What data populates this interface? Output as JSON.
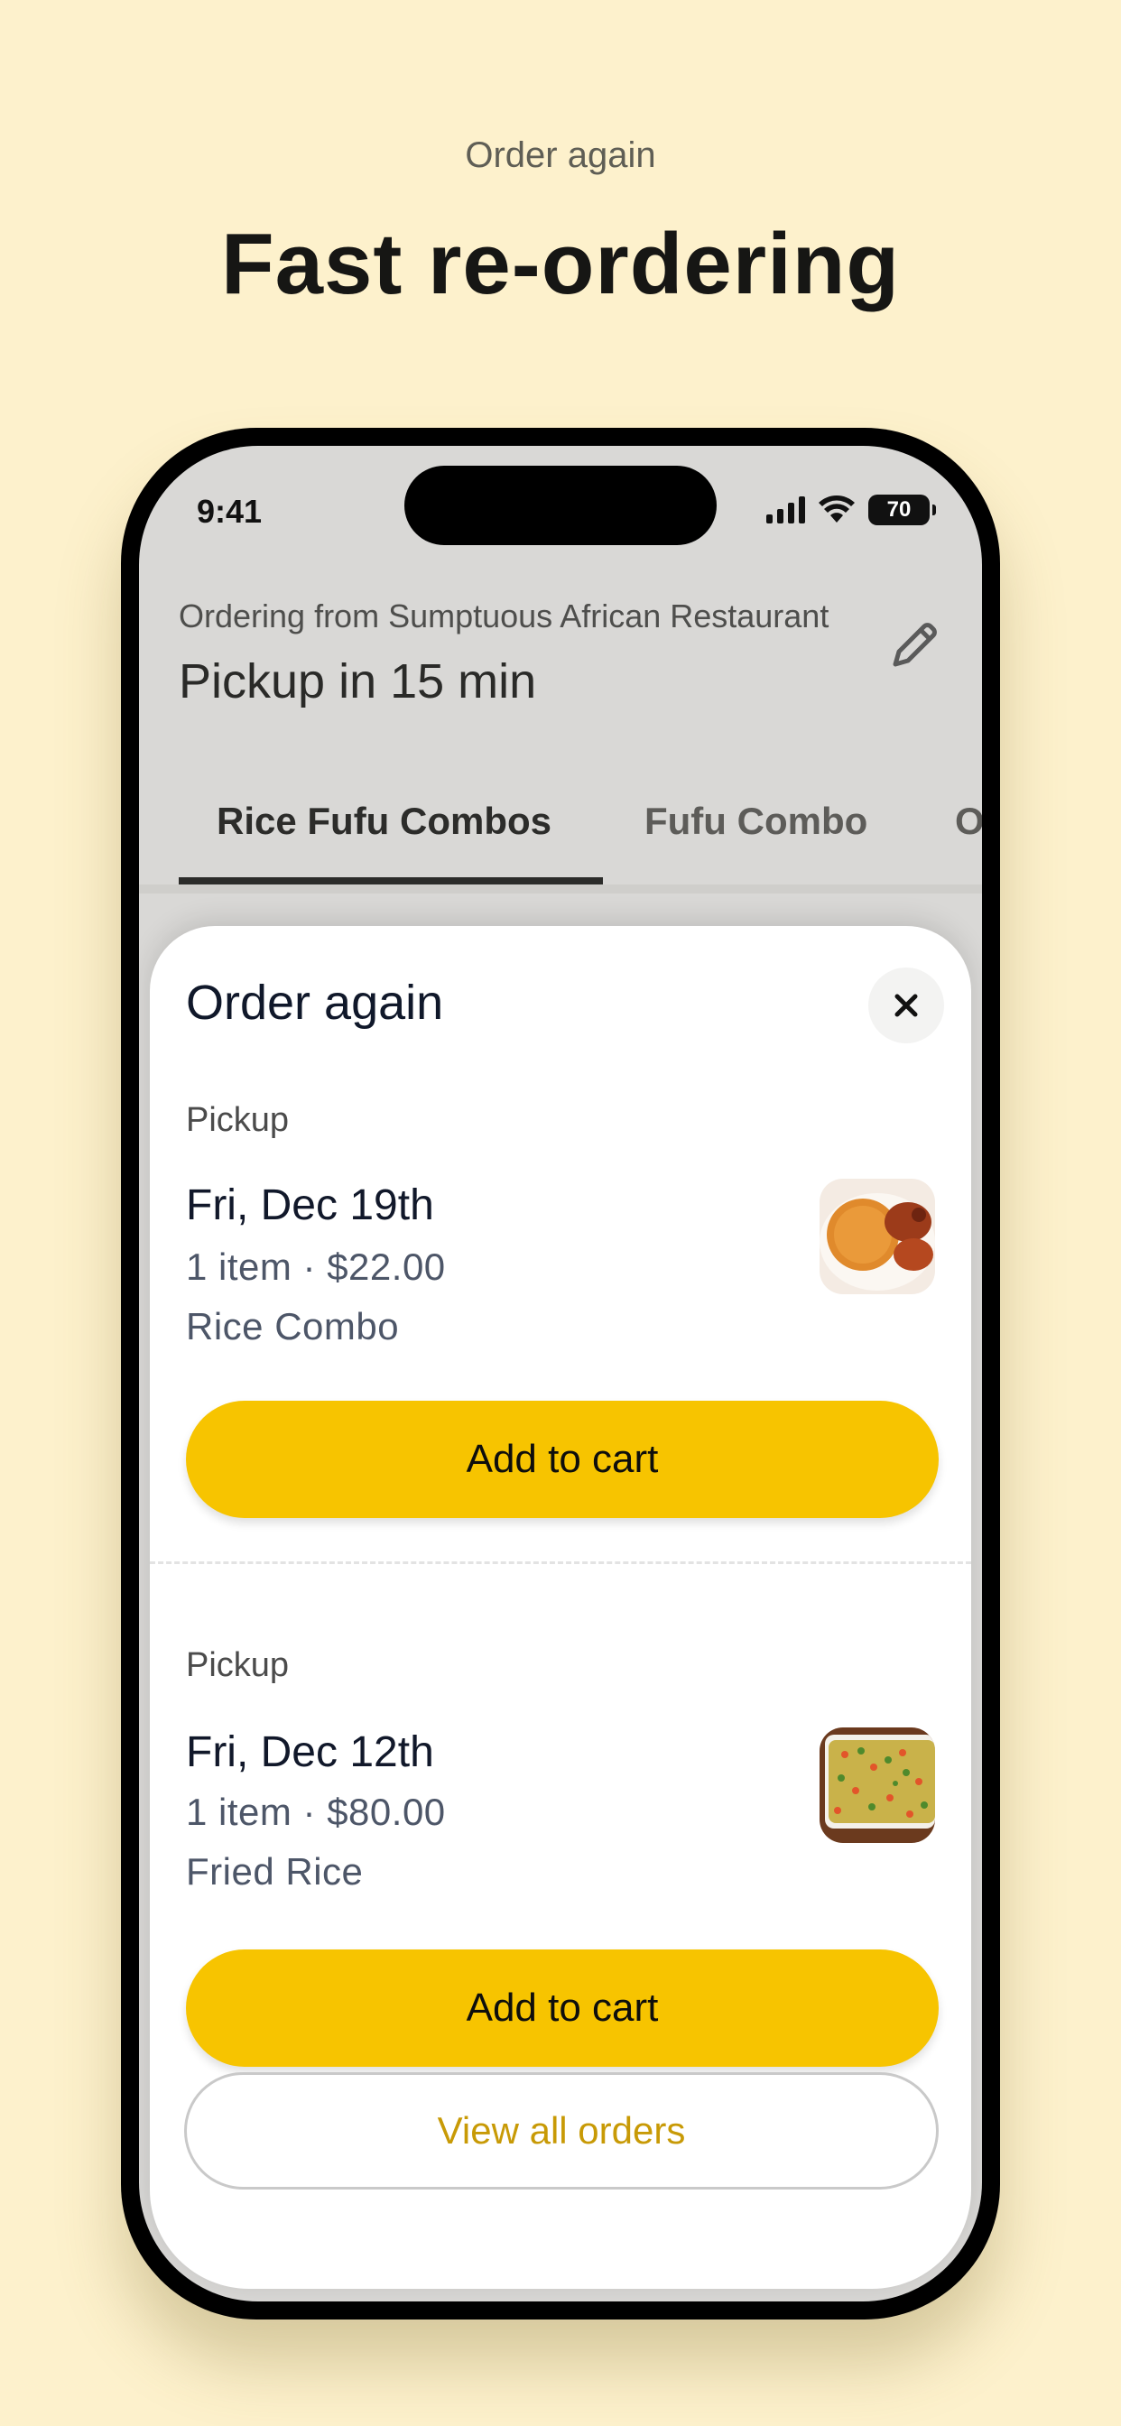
{
  "page": {
    "eyebrow": "Order again",
    "headline": "Fast re-ordering"
  },
  "status_bar": {
    "time": "9:41",
    "battery": "70",
    "icons": [
      "signal-icon",
      "wifi-icon",
      "battery-icon"
    ]
  },
  "header": {
    "ordering_from": "Ordering from Sumptuous African Restaurant",
    "pickup_time": "Pickup in 15 min",
    "edit_icon": "pencil-icon"
  },
  "tabs": [
    {
      "label": "Rice Fufu Combos",
      "active": true
    },
    {
      "label": "Fufu Combo",
      "active": false
    },
    {
      "label": "O",
      "active": false
    }
  ],
  "sheet": {
    "title": "Order again",
    "close_icon": "close-icon",
    "orders": [
      {
        "type": "Pickup",
        "date": "Fri, Dec 19th",
        "meta": "1 item · $22.00",
        "name": "Rice Combo",
        "image": "rice-combo-thumbnail",
        "button": "Add to cart"
      },
      {
        "type": "Pickup",
        "date": "Fri, Dec 12th",
        "meta": "1 item · $80.00",
        "name": "Fried Rice",
        "image": "fried-rice-thumbnail",
        "button": "Add to cart"
      }
    ],
    "view_all": "View all orders"
  },
  "colors": {
    "background": "#fdf1cc",
    "accent": "#f7c400",
    "link": "#c89a06"
  }
}
